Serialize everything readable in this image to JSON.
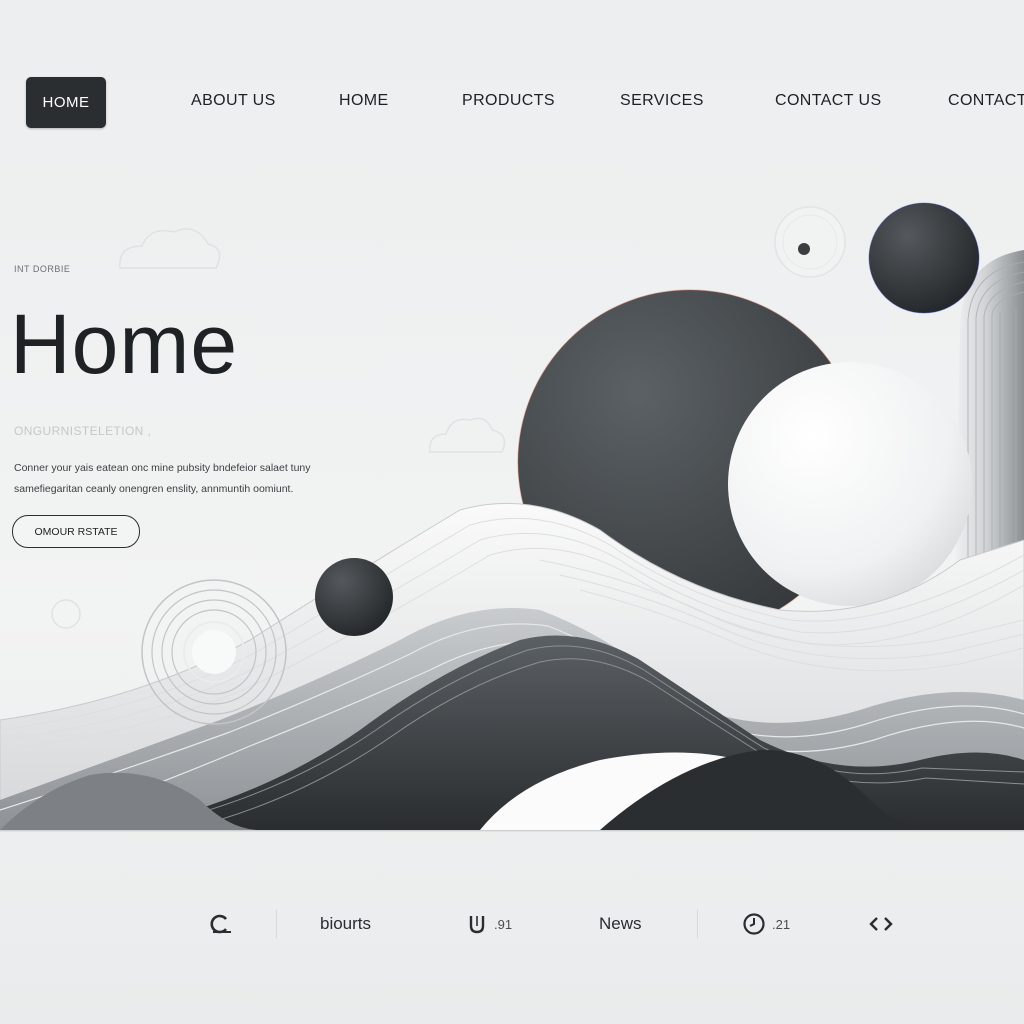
{
  "nav": {
    "active_label": "HOME",
    "items": [
      "ABOUT US",
      "HOME",
      "PRODUCTS",
      "SERVICES",
      "CONTACT US",
      "CONTACT"
    ]
  },
  "hero": {
    "kicker": "INT DORBIE",
    "title": "Home",
    "subtitle": "ONGURNISTELETION ,",
    "body_lines": [
      "Conner your yais eatean onc mine pubsity bndefeior salaet tuny",
      "samefiegaritan ceanly onengren enslity, annmuntih oomiunt."
    ],
    "cta_label": "OMOUR RSTATE"
  },
  "footer": {
    "items": [
      {
        "icon": "c-logo-icon",
        "text": ""
      },
      {
        "icon": "",
        "text": "biourts"
      },
      {
        "icon": "u-icon",
        "text": ".91"
      },
      {
        "icon": "",
        "text": "News"
      },
      {
        "icon": "clock-icon",
        "text": ".21"
      },
      {
        "icon": "code-arrows-icon",
        "text": ""
      }
    ]
  },
  "colors": {
    "background": "#eceeef",
    "dark_accent": "#2a2e31",
    "text": "#1f2326",
    "light_sphere": "#f7f8f9"
  }
}
